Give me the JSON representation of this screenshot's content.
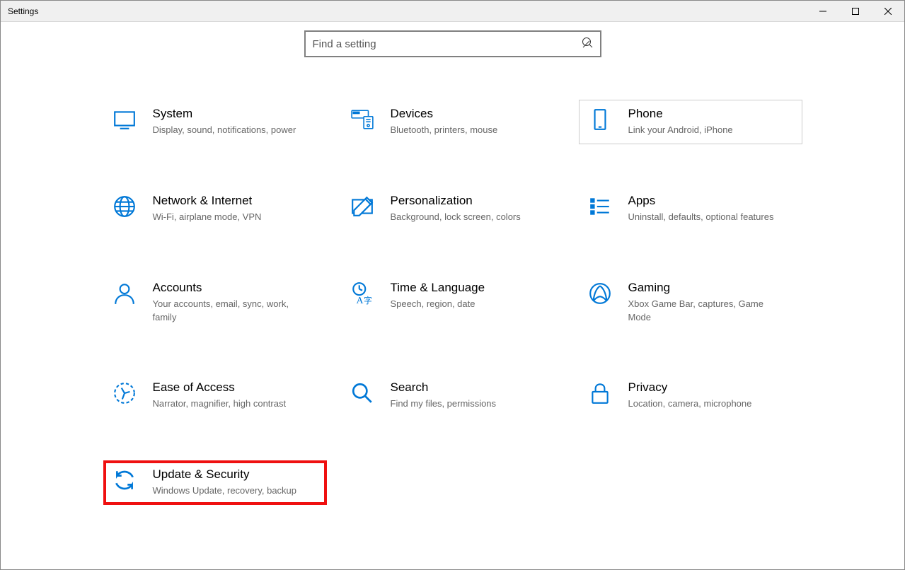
{
  "window": {
    "title": "Settings"
  },
  "search": {
    "placeholder": "Find a setting"
  },
  "tiles": {
    "system": {
      "title": "System",
      "desc": "Display, sound, notifications, power"
    },
    "devices": {
      "title": "Devices",
      "desc": "Bluetooth, printers, mouse"
    },
    "phone": {
      "title": "Phone",
      "desc": "Link your Android, iPhone"
    },
    "network": {
      "title": "Network & Internet",
      "desc": "Wi-Fi, airplane mode, VPN"
    },
    "personalization": {
      "title": "Personalization",
      "desc": "Background, lock screen, colors"
    },
    "apps": {
      "title": "Apps",
      "desc": "Uninstall, defaults, optional features"
    },
    "accounts": {
      "title": "Accounts",
      "desc": "Your accounts, email, sync, work, family"
    },
    "time": {
      "title": "Time & Language",
      "desc": "Speech, region, date"
    },
    "gaming": {
      "title": "Gaming",
      "desc": "Xbox Game Bar, captures, Game Mode"
    },
    "ease": {
      "title": "Ease of Access",
      "desc": "Narrator, magnifier, high contrast"
    },
    "search_tile": {
      "title": "Search",
      "desc": "Find my files, permissions"
    },
    "privacy": {
      "title": "Privacy",
      "desc": "Location, camera, microphone"
    },
    "update": {
      "title": "Update & Security",
      "desc": "Windows Update, recovery, backup"
    }
  }
}
